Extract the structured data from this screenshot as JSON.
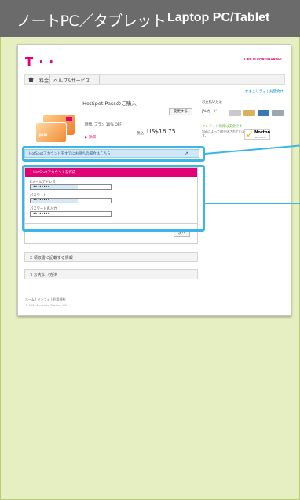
{
  "header": {
    "title_ja": "ノートPC／タブレット",
    "title_en": "Laptop PC/Tablet"
  },
  "site": {
    "logo": "T · ·",
    "slogan": "LIFE IS FOR SHARING."
  },
  "nav": {
    "items": [
      "料金",
      "ヘルプ&サービス"
    ]
  },
  "links": {
    "security": "セキュリティ | お問合せ"
  },
  "purchase": {
    "title": "HotSpot Passのご購入",
    "change_button": "変更する",
    "plan_text": "時間, プラン 10% OFF",
    "details_link": "▶ 詳細",
    "tax_label": "税込",
    "price": "US$16.75",
    "card_label": "pass"
  },
  "existing_account_bar": {
    "text": "HotSpotアカウントをすでにお持ちの場合はこちら",
    "icon": "person-arrow-icon"
  },
  "create_account": {
    "header": "1 HotSpotアカウントを作成",
    "fields": [
      {
        "label": "Eメールアドレス",
        "value": "••••••••"
      },
      {
        "label": "パスワード",
        "value": "••••••••"
      },
      {
        "label": "パスワード再入力",
        "value": "••••••••"
      }
    ],
    "next_button": "次へ"
  },
  "steps": {
    "step2": "2 領収書に記載する情報",
    "step3": "3 お支払い方法"
  },
  "right_column": {
    "payment_label": "お支払い方法",
    "card_text": "JALカード",
    "secure_text": "クレジット情報は安全です",
    "ssl_text": "SSLによって暗号化されています。",
    "norton_name": "Norton",
    "norton_sub": "SECURED",
    "card_colors": [
      "#c9c9c9",
      "#d9b25a",
      "#3a78b4",
      "#9aa6b0"
    ]
  },
  "footer": {
    "links": "ホーム | インフォ | 利用規約",
    "copyright": "© 2014 Deutsche Telekom AG"
  },
  "colors": {
    "magenta": "#e20074",
    "highlight": "#3ab6e7",
    "header_bg": "#6b6b6b",
    "page_bg": "#e6efc2"
  }
}
